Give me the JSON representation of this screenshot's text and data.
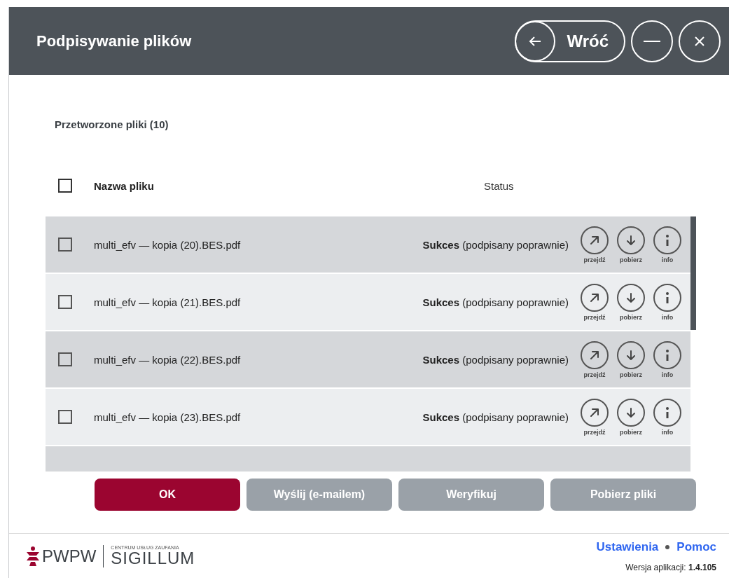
{
  "window": {
    "title": "Podpisywanie plików",
    "back_label": "Wróć"
  },
  "section_title": "Przetworzone pliki (10)",
  "table": {
    "select_all_checked": false,
    "columns": [
      "Nazwa pliku",
      "Status"
    ],
    "rows": [
      {
        "name": "multi_efv — kopia (20).BES.pdf",
        "status_bold": "Sukces",
        "status_detail": "(podpisany poprawnie)",
        "checked": false,
        "actions": [
          "przejdź",
          "pobierz",
          "info"
        ]
      },
      {
        "name": "multi_efv — kopia (21).BES.pdf",
        "status_bold": "Sukces",
        "status_detail": "(podpisany poprawnie)",
        "checked": false,
        "actions": [
          "przejdź",
          "pobierz",
          "info"
        ]
      },
      {
        "name": "multi_efv — kopia (22).BES.pdf",
        "status_bold": "Sukces",
        "status_detail": "(podpisany poprawnie)",
        "checked": false,
        "actions": [
          "przejdź",
          "pobierz",
          "info"
        ]
      },
      {
        "name": "multi_efv — kopia (23).BES.pdf",
        "status_bold": "Sukces",
        "status_detail": "(podpisany poprawnie)",
        "checked": false,
        "actions": [
          "przejdź",
          "pobierz",
          "info"
        ]
      }
    ]
  },
  "buttons": [
    {
      "label": "OK",
      "kind": "primary"
    },
    {
      "label": "Wyślij (e-mailem)",
      "kind": "secondary"
    },
    {
      "label": "Weryfikuj",
      "kind": "secondary"
    },
    {
      "label": "Pobierz pliki",
      "kind": "secondary"
    }
  ],
  "footer": {
    "logo": {
      "brand": "PWPW",
      "tagline": "CENTRUM USŁUG ZAUFANIA",
      "product": "SIGILLUM"
    },
    "links": [
      "Ustawienia",
      "Pomoc"
    ],
    "version_label": "Wersja aplikacji:",
    "version": "1.4.105"
  }
}
